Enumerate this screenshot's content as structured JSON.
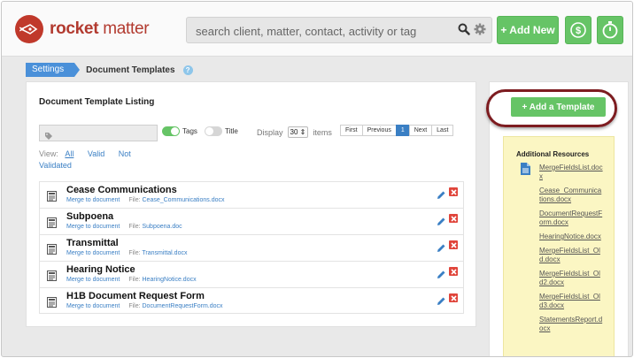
{
  "header": {
    "logo_bold": "rocket",
    "logo_light": " matter",
    "search_placeholder": "search client, matter, contact, activity or tag",
    "add_new_label": "+ Add New"
  },
  "breadcrumb": {
    "settings": "Settings",
    "current": "Document Templates",
    "help": "?"
  },
  "listing": {
    "title": "Document Template Listing",
    "tags_label": "Tags",
    "title_toggle_label": "Title",
    "display_label": "Display",
    "display_value": "30",
    "items_label": "items",
    "pager": [
      "First",
      "Previous",
      "1",
      "Next",
      "Last"
    ],
    "view_label": "View:",
    "view_all": "All",
    "view_valid": "Valid",
    "view_not": "Not",
    "view_validated": "Validated",
    "merge_label": "Merge to document",
    "file_label": "File:",
    "rows": [
      {
        "title": "Cease Communications",
        "file": "Cease_Communications.docx"
      },
      {
        "title": "Subpoena",
        "file": "Subpoena.doc"
      },
      {
        "title": "Transmittal",
        "file": "Transmittal.docx"
      },
      {
        "title": "Hearing Notice",
        "file": "HearingNotice.docx"
      },
      {
        "title": "H1B Document Request Form",
        "file": "DocumentRequestForm.docx"
      }
    ]
  },
  "sidebar": {
    "add_template_label": "+ Add a Template",
    "resources_title": "Additional Resources",
    "resources": [
      "MergeFieldsList.docx",
      "Cease_Communications.docx",
      "DocumentRequestForm.docx",
      "HearingNotice.docx",
      "MergeFieldsList_Old.docx",
      "MergeFieldsList_Old2.docx",
      "MergeFieldsList_Old3.docx",
      "StatementsReport.docx"
    ]
  },
  "colors": {
    "brand_red": "#b23a2f",
    "green": "#66c466",
    "link_blue": "#3a7fc4",
    "highlight_ring": "#7d1c20"
  }
}
